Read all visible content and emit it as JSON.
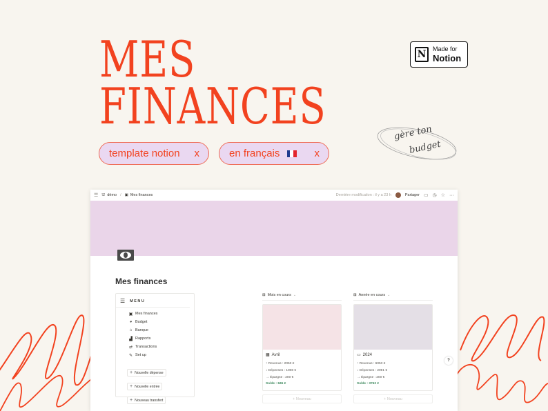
{
  "hero": {
    "title_line1": "MES",
    "title_line2": "FINANCES",
    "chips": [
      {
        "label": "template notion",
        "close": "x"
      },
      {
        "label": "en français",
        "close": "x",
        "flag": [
          "#1f3b8f",
          "#ffffff",
          "#e3262d"
        ]
      }
    ],
    "badge": {
      "small": "Made for",
      "big": "Notion",
      "logo": "N"
    },
    "sticker": {
      "line1": "gère ton",
      "line2": "budget"
    }
  },
  "colors": {
    "accent": "#f2421f",
    "background": "#f8f5ef",
    "chip_fill": "#ead8f1",
    "cover": "#ead5e9",
    "solde_green": "#3f8a5f"
  },
  "window": {
    "breadcrumb": [
      {
        "icon": "workspace-icon",
        "glyph": "⛫",
        "label": "démo"
      },
      {
        "icon": "money-icon",
        "glyph": "▣",
        "label": "Mes finances"
      }
    ],
    "breadcrumb_sep": "/",
    "last_edit": "Dernière modification : il y a 23 h",
    "share_label": "Partager",
    "page_title": "Mes finances",
    "menu": {
      "heading": "MENU",
      "items": [
        {
          "icon": "money-icon",
          "glyph": "▣",
          "label": "Mes finances"
        },
        {
          "icon": "pie-chart-icon",
          "glyph": "◕",
          "label": "Budget"
        },
        {
          "icon": "bank-icon",
          "glyph": "⌂",
          "label": "Banque"
        },
        {
          "icon": "bar-chart-icon",
          "glyph": "▟",
          "label": "Rapports"
        },
        {
          "icon": "transfer-icon",
          "glyph": "⇄",
          "label": "Transactions"
        },
        {
          "icon": "wrench-icon",
          "glyph": "🔧",
          "label": "Set up"
        }
      ],
      "actions": [
        {
          "label": "Nouvelle dépense"
        },
        {
          "label": "Nouvelle entrée"
        },
        {
          "label": "Nouveau transfert"
        }
      ]
    },
    "galleries": [
      {
        "view_label": "Mois en cours",
        "thumb_color": "#f5e3e6",
        "card": {
          "title": "Avril",
          "revenus": "↑ Revenus : 2053 €",
          "depenses": "↓ Dépenses : 1008 €",
          "epargne": "→ Épargne : 200 €",
          "solde": "Solde : 845 €"
        },
        "new_label": "+ Nouveau"
      },
      {
        "view_label": "Année en cours",
        "thumb_color": "#e4dfe6",
        "card": {
          "title": "2024",
          "revenus": "↑ Revenus : 6053 €",
          "depenses": "↓ Dépenses : 2091 €",
          "epargne": "→ Épargne : 200 €",
          "solde": "Solde : 3762 €"
        },
        "new_label": "+ Nouveau"
      }
    ],
    "help_label": "?"
  }
}
